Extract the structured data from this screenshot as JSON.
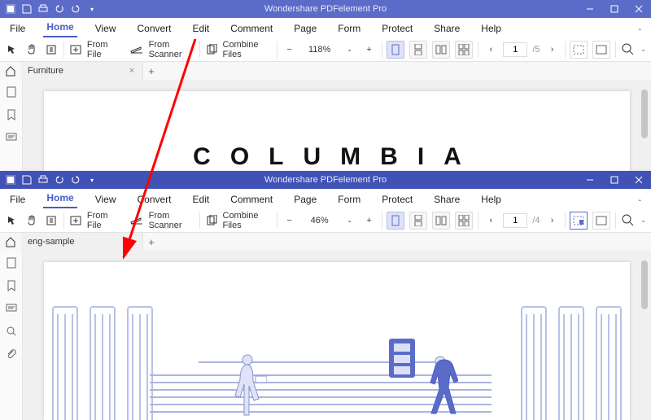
{
  "windows": [
    {
      "title": "Wondershare PDFelement Pro",
      "tab": "Furniture",
      "zoom": "118%",
      "page_current": "1",
      "page_total": "/5",
      "doc_text": "COLUMBIA"
    },
    {
      "title": "Wondershare PDFelement Pro",
      "tab": "eng-sample",
      "zoom": "46%",
      "page_current": "1",
      "page_total": "/4"
    }
  ],
  "menu": {
    "file": "File",
    "home": "Home",
    "view": "View",
    "convert": "Convert",
    "edit": "Edit",
    "comment": "Comment",
    "page": "Page",
    "form": "Form",
    "protect": "Protect",
    "share": "Share",
    "help": "Help"
  },
  "toolbar": {
    "from_file": "From File",
    "from_scanner": "From Scanner",
    "combine": "Combine Files"
  }
}
